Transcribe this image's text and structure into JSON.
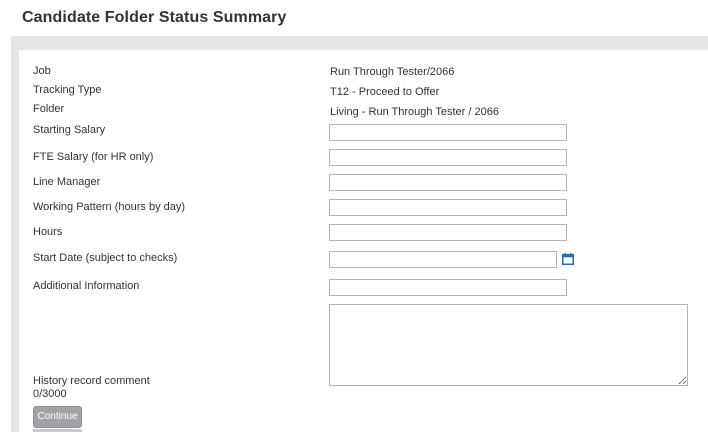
{
  "page": {
    "title": "Candidate Folder Status Summary"
  },
  "info": {
    "job_label": "Job",
    "job_value": "Run Through Tester/2066",
    "tracking_type_label": "Tracking Type",
    "tracking_type_value": "T12 - Proceed to Offer",
    "folder_label": "Folder",
    "folder_value": "Living - Run Through Tester / 2066"
  },
  "form": {
    "starting_salary": {
      "label": "Starting Salary",
      "value": ""
    },
    "fte_salary": {
      "label": "FTE Salary (for HR only)",
      "value": ""
    },
    "line_manager": {
      "label": "Line Manager",
      "value": ""
    },
    "working_pattern": {
      "label": "Working Pattern (hours by day)",
      "value": ""
    },
    "hours": {
      "label": "Hours",
      "value": ""
    },
    "start_date": {
      "label": "Start Date (subject to checks)",
      "value": "",
      "icon": "calendar-icon"
    },
    "additional_information": {
      "label": "Additional Information",
      "value": ""
    },
    "history_comment": {
      "label": "History record comment",
      "counter": "0/3000",
      "value": ""
    }
  },
  "actions": {
    "continue_label": "Continue"
  },
  "colors": {
    "panel_background": "#e4e6e9",
    "button_background": "#9fa2a6",
    "calendar_icon": "#1f6fb5",
    "field_border": "#b4b4b4"
  }
}
